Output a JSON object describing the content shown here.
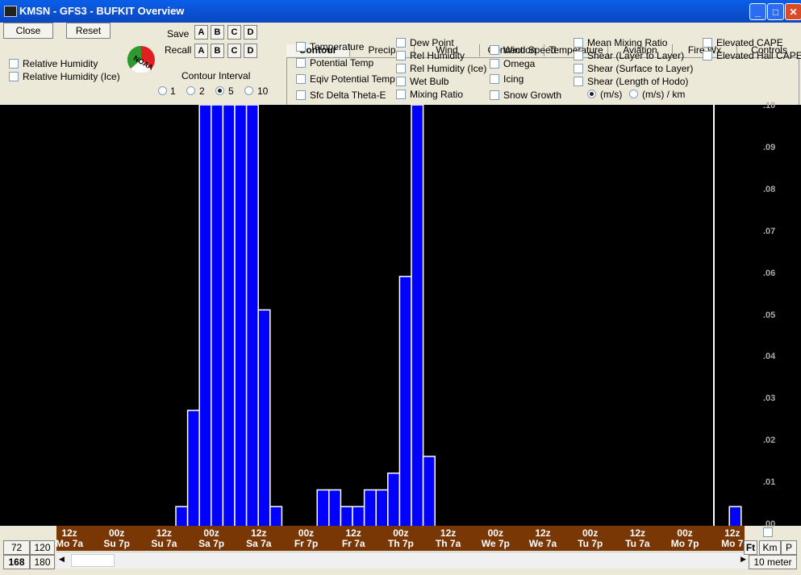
{
  "window": {
    "title": "KMSN - GFS3 - BUFKIT Overview"
  },
  "buttons": {
    "close": "Close",
    "reset": "Reset"
  },
  "left_checkboxes": [
    "Relative Humidity",
    "Relative Humidity (Ice)"
  ],
  "save": {
    "label": "Save",
    "slots": [
      "A",
      "B",
      "C",
      "D"
    ]
  },
  "recall": {
    "label": "Recall",
    "slots": [
      "A",
      "B",
      "C",
      "D"
    ]
  },
  "logo_text": "NOAA",
  "contour_interval": {
    "label": "Contour Interval",
    "options": [
      "1",
      "2",
      "5",
      "10"
    ],
    "selected": "5"
  },
  "tabs": [
    "Contour",
    "Precip",
    "Wind",
    "Convection",
    "Temperature",
    "Aviation",
    "Fire Wx",
    "Controls"
  ],
  "active_tab": "Contour",
  "options": {
    "col1": [
      "Temperature",
      "Potential Temp",
      "Eqiv Potential Temp",
      "Sfc Delta Theta-E"
    ],
    "col2": [
      "Dew Point",
      "Rel Humidity",
      "Rel Humidity (Ice)",
      "Wet Bulb",
      "Mixing Ratio"
    ],
    "col3": [
      "Wind Speed",
      "Omega",
      "Icing",
      "Snow Growth"
    ],
    "col4": [
      "Mean Mixing Ratio",
      "Shear (Layer to Layer)",
      "Shear (Surface to Layer)",
      "Shear (Length of Hodo)"
    ],
    "col5": [
      "Elevated CAPE",
      "Elevated Hail CAPE"
    ],
    "shear_units": [
      "(m/s)",
      "(m/s) / km"
    ],
    "shear_unit_selected": "(m/s)"
  },
  "y_ticks": [
    ".10",
    ".09",
    ".08",
    ".07",
    ".06",
    ".05",
    ".04",
    ".03",
    ".02",
    ".01",
    ".00"
  ],
  "chart_data": {
    "type": "bar",
    "ylim": [
      0,
      0.1
    ],
    "values": [
      0.004,
      0.027,
      0.1,
      0.1,
      0.1,
      0.1,
      0.1,
      0.051,
      0.004,
      0,
      0,
      0,
      0.008,
      0.008,
      0.004,
      0.004,
      0.008,
      0.008,
      0.012,
      0.059,
      0.1,
      0.016,
      0,
      0,
      0,
      0,
      0,
      0,
      0,
      0,
      0,
      0,
      0,
      0,
      0,
      0,
      0,
      0,
      0,
      0,
      0,
      0,
      0,
      0,
      0,
      0,
      0,
      0.004
    ]
  },
  "x_labels": [
    [
      "12z",
      "Mo 7a"
    ],
    [
      "00z",
      "Su 7p"
    ],
    [
      "12z",
      "Su 7a"
    ],
    [
      "00z",
      "Sa 7p"
    ],
    [
      "12z",
      "Sa 7a"
    ],
    [
      "00z",
      "Fr 7p"
    ],
    [
      "12z",
      "Fr 7a"
    ],
    [
      "00z",
      "Th 7p"
    ],
    [
      "12z",
      "Th 7a"
    ],
    [
      "00z",
      "We 7p"
    ],
    [
      "12z",
      "We 7a"
    ],
    [
      "00z",
      "Tu 7p"
    ],
    [
      "12z",
      "Tu 7a"
    ],
    [
      "00z",
      "Mo 7p"
    ],
    [
      "12z",
      "Mo 7"
    ]
  ],
  "hour_buttons": [
    "72",
    "120",
    "168",
    "180"
  ],
  "hour_selected": "168",
  "units_buttons": [
    "Ft",
    "Km",
    "P"
  ],
  "level_label": "10 meter"
}
